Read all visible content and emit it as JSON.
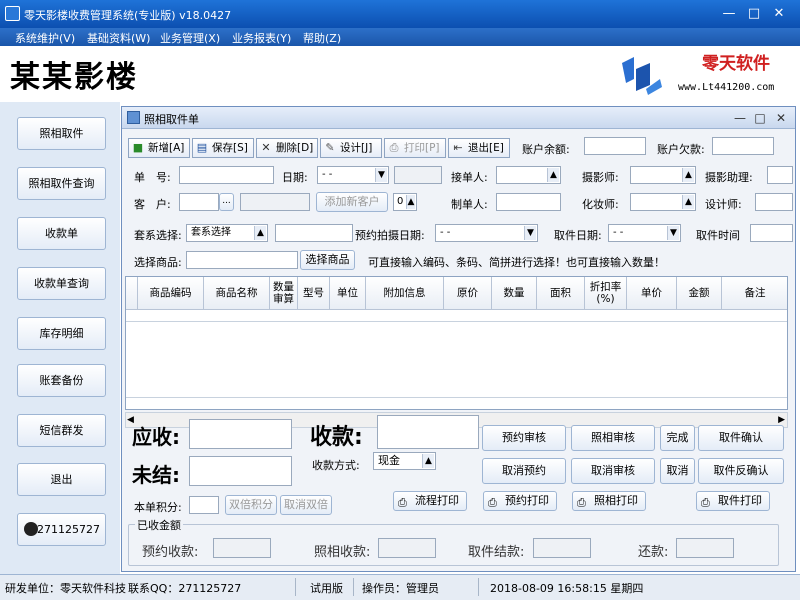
{
  "window": {
    "title": "零天影楼收费管理系统(专业版)  v18.0427"
  },
  "menu": [
    "系统维护(V)",
    "基础资料(W)",
    "业务管理(X)",
    "业务报表(Y)",
    "帮助(Z)"
  ],
  "brand": {
    "name": "某某影楼",
    "logo_title": "零天软件",
    "logo_url": "www.Lt441200.com"
  },
  "sidebar": [
    "照相取件",
    "照相取件查询",
    "收款单",
    "收款单查询",
    "库存明细",
    "账套备份",
    "短信群发",
    "退出",
    "271125727"
  ],
  "child": {
    "title": "照相取件单"
  },
  "toolbar": [
    "新增[A]",
    "保存[S]",
    "删除[D]",
    "设计[J]",
    "打印[P]",
    "退出[E]"
  ],
  "account": {
    "balance_label": "账户余额:",
    "debt_label": "账户欠款:"
  },
  "form": {
    "order_no": "单　号:",
    "date": "日期:",
    "date_value": " - -",
    "receiver": "接单人:",
    "photographer": "摄影师:",
    "photo_assistant": "摄影助理:",
    "customer": "客　户:",
    "add_customer": "添加新客户",
    "customer_count": "0",
    "maker": "制单人:",
    "makeup": "化妆师:",
    "designer": "设计师:",
    "package_select": "套系选择:",
    "package_value": "套系选择",
    "appointment_date": "预约拍摄日期:",
    "appointment_value": " - -",
    "pickup_date": "取件日期:",
    "pickup_value": " - -",
    "pickup_time": "取件时间",
    "select_product_label": "选择商品:",
    "select_product_btn": "选择商品",
    "hint": "可直接输入编码、条码、简拼进行选择！也可直接输入数量！"
  },
  "table": {
    "columns": [
      "商品编码",
      "商品名称",
      "数量审算",
      "型号",
      "单位",
      "附加信息",
      "原价",
      "数量",
      "面积",
      "折扣率(%)",
      "单价",
      "金额",
      "备注"
    ]
  },
  "summary": {
    "receivable": "应收:",
    "received": "收款:",
    "outstanding": "未结:",
    "payment_method": "收款方式:",
    "payment_value": "现金",
    "points": "本单积分:",
    "double_points": "双倍积分",
    "cancel_double": "取消双倍"
  },
  "actions": {
    "appointment_audit": "预约审核",
    "photo_audit": "照相审核",
    "complete": "完成",
    "pickup_confirm": "取件确认",
    "cancel_appointment": "取消预约",
    "cancel_audit": "取消审核",
    "cancel": "取消",
    "pickup_reverse": "取件反确认",
    "process_print": "流程打印",
    "appointment_print": "预约打印",
    "photo_print": "照相打印",
    "pickup_print": "取件打印"
  },
  "received_amounts": {
    "title": "已收金额",
    "appointment": "预约收款:",
    "photo": "照相收款:",
    "pickup": "取件结款:",
    "repay": "还款:"
  },
  "status": {
    "developer": "研发单位：零天软件科技",
    "qq": "联系QQ：271125727",
    "edition": "试用版",
    "operator": "操作员：管理员",
    "datetime": "2018-08-09 16:58:15 星期四"
  }
}
